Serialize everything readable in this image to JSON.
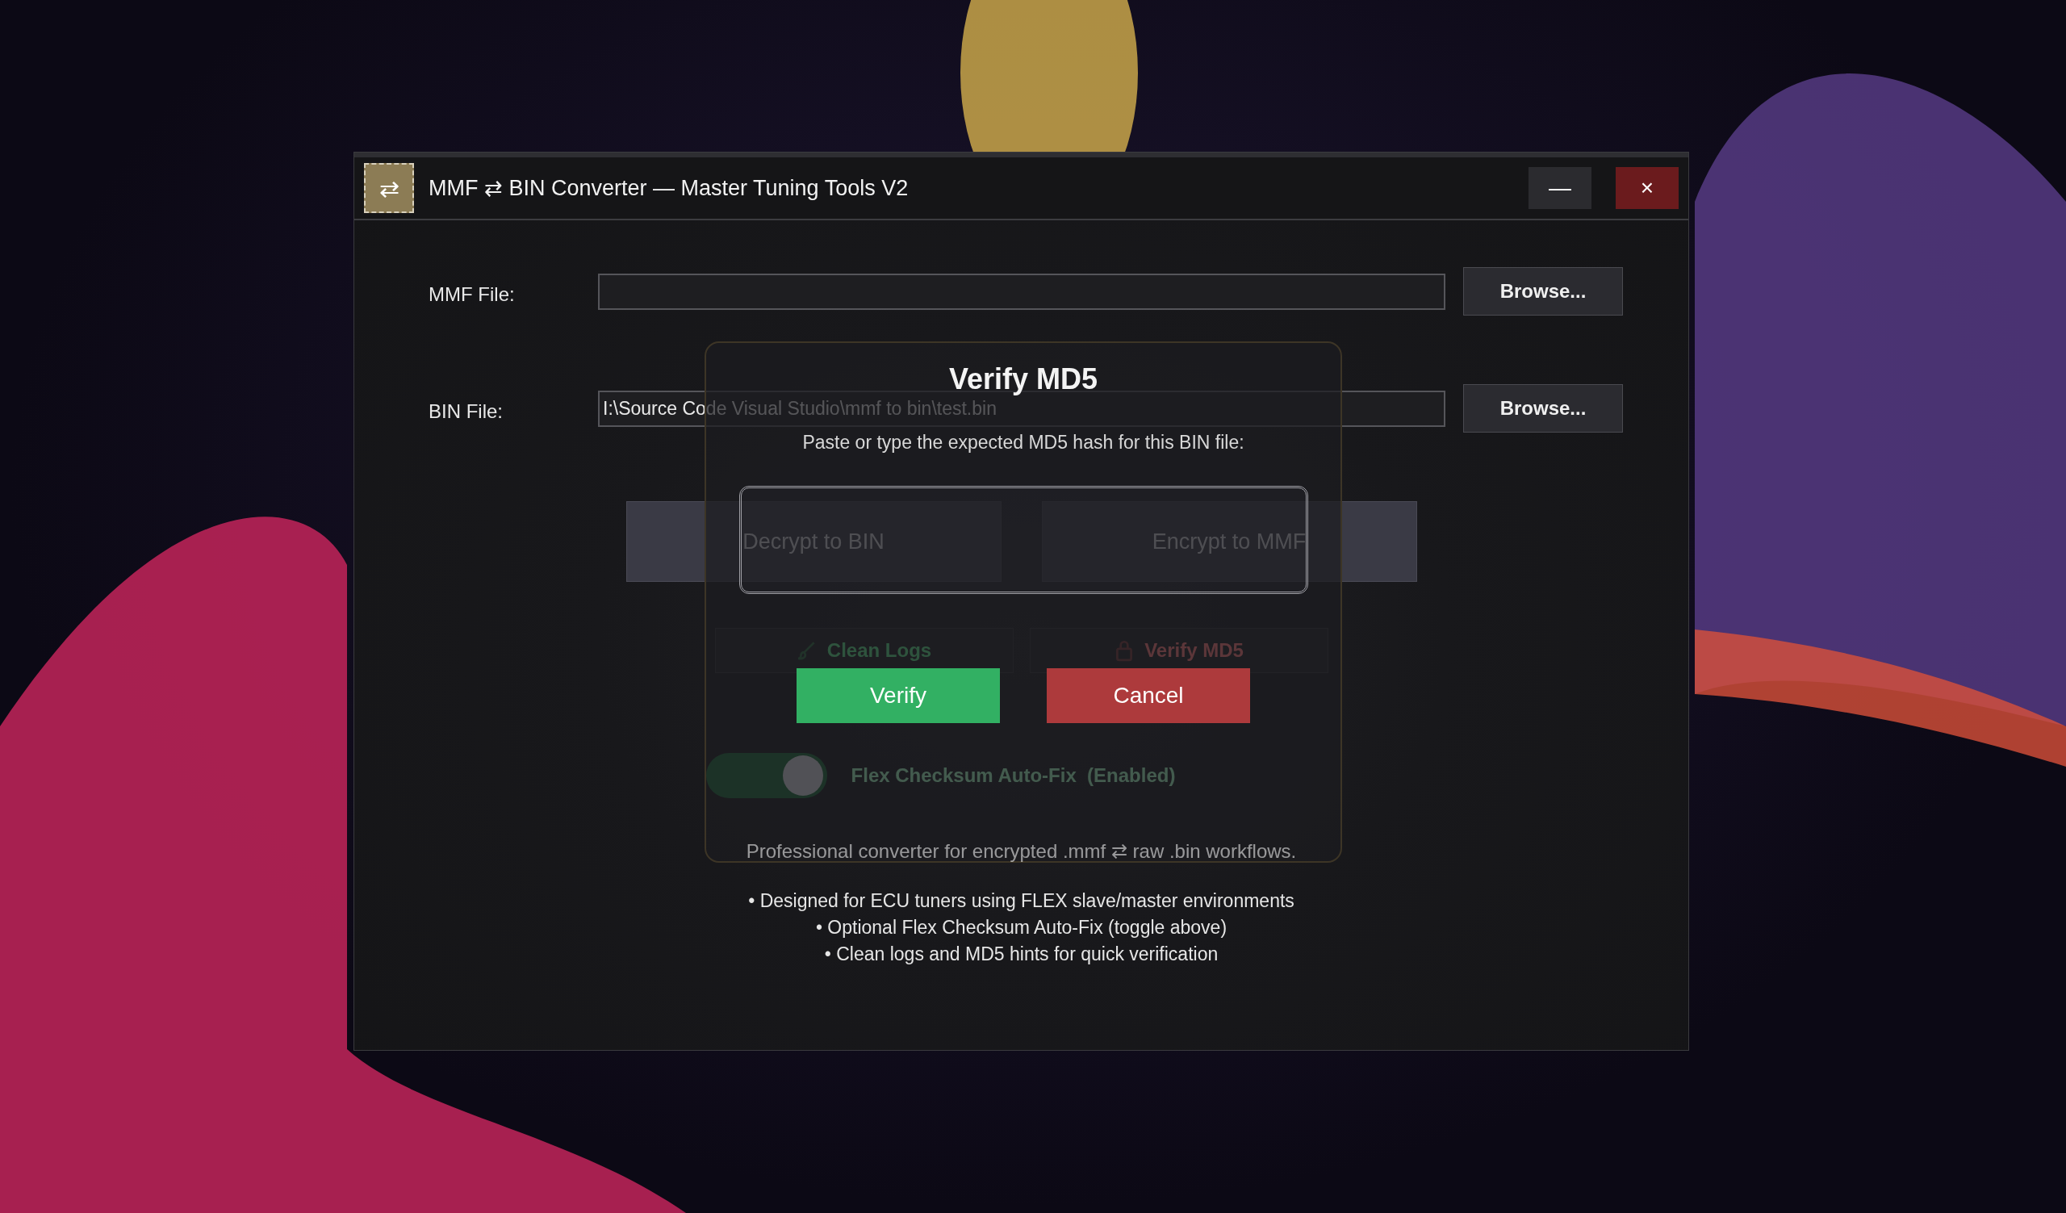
{
  "window": {
    "icon": "⇄",
    "title": "MMF ⇄ BIN Converter — Master Tuning Tools V2",
    "minimize": "—",
    "close": "×"
  },
  "fields": [
    {
      "label": "MMF File:",
      "button": "Browse..."
    },
    {
      "label": "BIN File:",
      "value": "I:\\Source Code Visual Studio\\mmf to bin\\test.bin",
      "button": "Browse..."
    }
  ],
  "actions": [
    "Decrypt to BIN",
    "Encrypt to MMF"
  ],
  "tools": [
    {
      "kind": "clean",
      "label": "Clean Logs"
    },
    {
      "kind": "verify",
      "label": "Verify MD5"
    }
  ],
  "toggle": {
    "label": "Flex Checksum Auto-Fix  (Enabled)",
    "on": true
  },
  "tagline": "Professional converter for encrypted .mmf ⇄ raw .bin workflows.",
  "bullets": [
    "• Designed for ECU tuners using FLEX slave/master environments",
    "• Optional Flex Checksum Auto-Fix (toggle above)",
    "• Clean logs and MD5 hints for quick verification"
  ],
  "dialog": {
    "title": "Verify MD5",
    "prompt": "Paste or type the expected MD5 hash for this BIN file:",
    "buttons": [
      {
        "kind": "confirm",
        "label": "Verify"
      },
      {
        "kind": "cancel",
        "label": "Cancel"
      }
    ]
  }
}
